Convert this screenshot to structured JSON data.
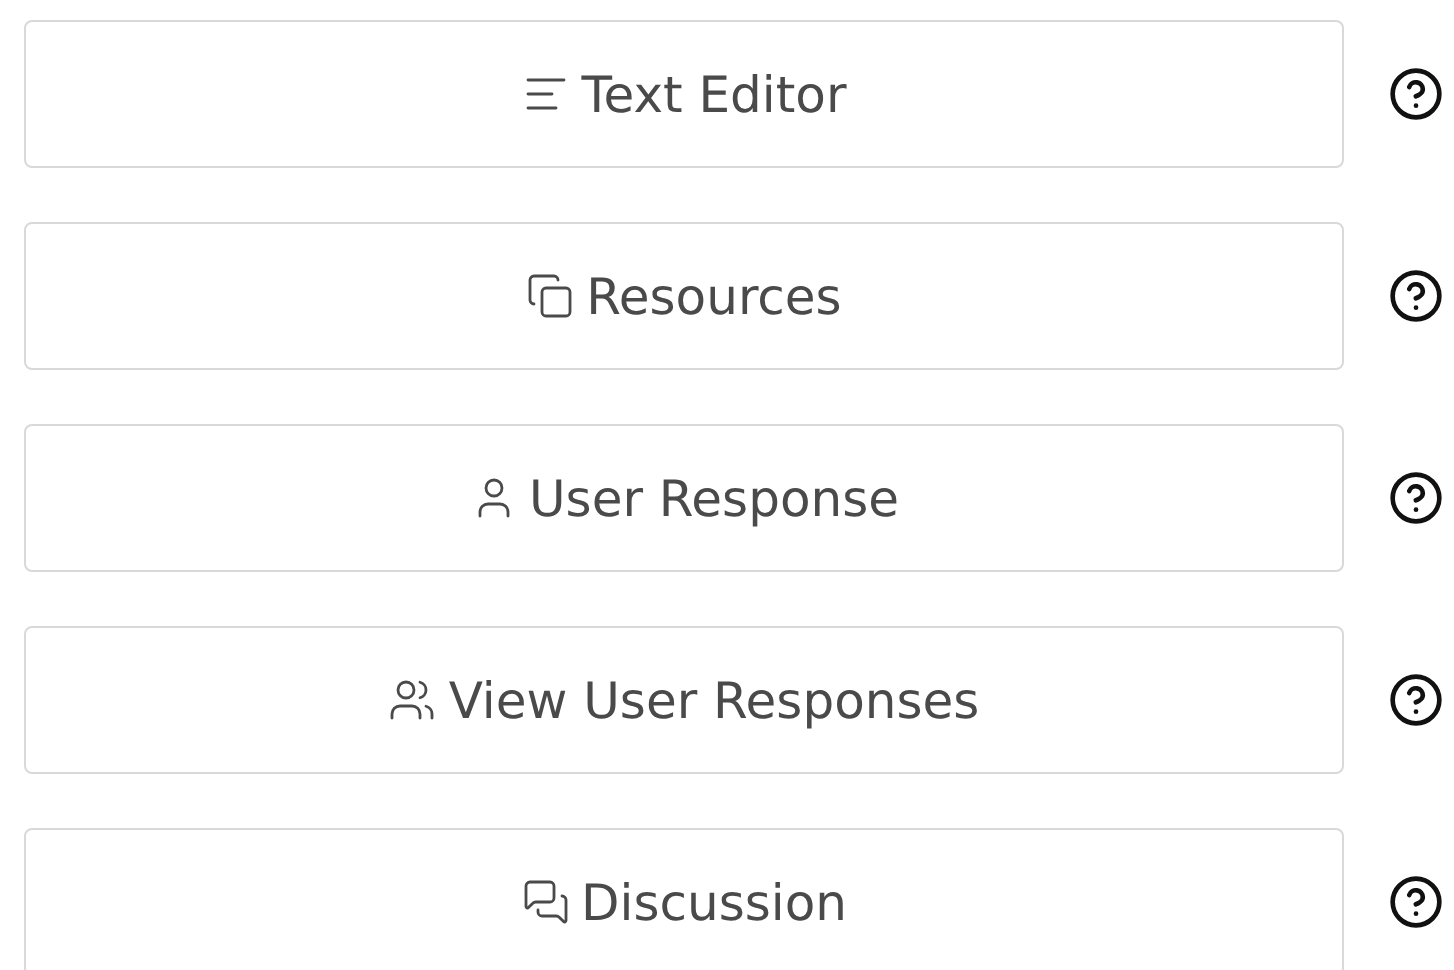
{
  "buttons": [
    {
      "label": "Text Editor",
      "help": true
    },
    {
      "label": "Resources",
      "help": true
    },
    {
      "label": "User Response",
      "help": true
    },
    {
      "label": "View User Responses",
      "help": true
    },
    {
      "label": "Discussion",
      "help": true
    }
  ]
}
